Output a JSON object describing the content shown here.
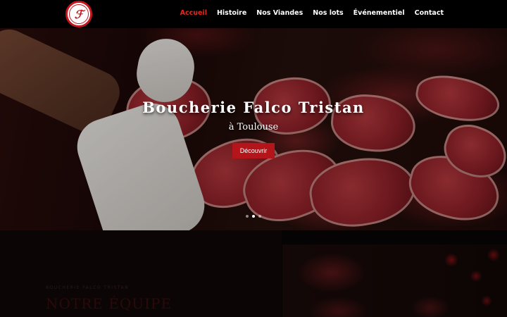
{
  "header": {
    "nav": [
      {
        "label": "Accueil",
        "active": true
      },
      {
        "label": "Histoire"
      },
      {
        "label": "Nos Viandes"
      },
      {
        "label": "Nos lots"
      },
      {
        "label": "Événementiel"
      },
      {
        "label": "Contact"
      }
    ]
  },
  "hero": {
    "title": "Boucherie Falco Tristan",
    "subtitle": "à Toulouse",
    "button_label": "Découvrir",
    "slide_count": 3,
    "active_slide": 2
  },
  "section": {
    "eyebrow": "BOUCHERIE FALCO TRISTAN",
    "title": "NOTRE ÉQUIPE"
  },
  "colors": {
    "accent": "#c4161c",
    "nav_active": "#e0281e",
    "background": "#000000"
  },
  "icons": {
    "logo": "logo-emblem"
  }
}
